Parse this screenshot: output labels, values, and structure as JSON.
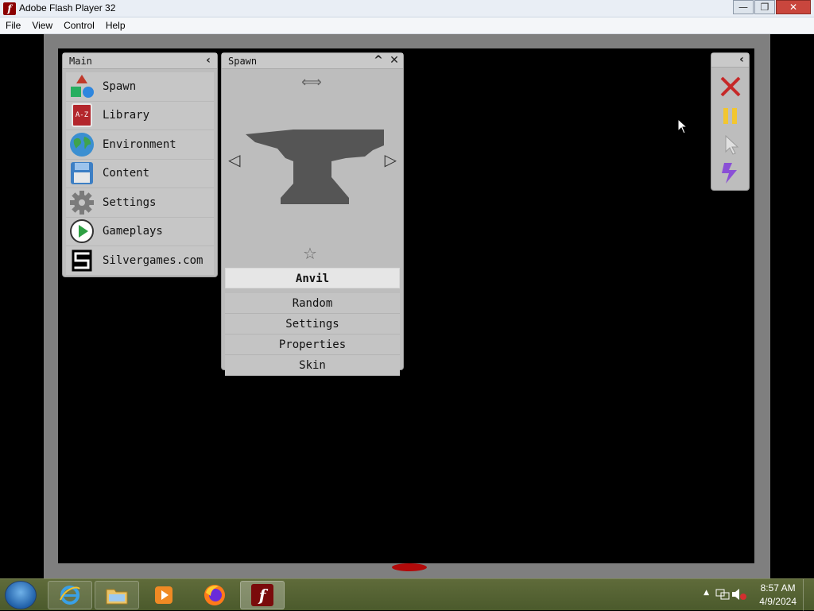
{
  "window": {
    "title": "Adobe Flash Player 32",
    "app_icon": "f",
    "buttons": {
      "minimize": "—",
      "maximize": "❐",
      "close": "✕"
    }
  },
  "menubar": {
    "items": [
      "File",
      "View",
      "Control",
      "Help"
    ]
  },
  "main_panel": {
    "title": "Main",
    "collapse_glyph": "‹",
    "items": [
      {
        "label": "Spawn",
        "icon": "shapes-icon"
      },
      {
        "label": "Library",
        "icon": "library-book-icon"
      },
      {
        "label": "Environment",
        "icon": "globe-icon"
      },
      {
        "label": "Content",
        "icon": "floppy-disk-icon"
      },
      {
        "label": "Settings",
        "icon": "gear-icon"
      },
      {
        "label": "Gameplays",
        "icon": "play-icon"
      },
      {
        "label": "Silvergames.com",
        "icon": "silvergames-logo-icon"
      }
    ],
    "library_icon_text": "A-Z"
  },
  "spawn_panel": {
    "title": "Spawn",
    "collapse_glyph": "^",
    "close_glyph": "✕",
    "move_glyph": "⟺",
    "prev_glyph": "◁",
    "next_glyph": "▷",
    "favorite_glyph": "☆",
    "selected_item": "Anvil",
    "buttons": [
      "Random",
      "Settings",
      "Properties",
      "Skin"
    ]
  },
  "tool_panel": {
    "collapse_glyph": "‹",
    "tools": [
      "delete-x-icon",
      "pause-icon",
      "pointer-icon",
      "lightning-icon"
    ]
  },
  "taskbar": {
    "apps": [
      "internet-explorer-icon",
      "file-explorer-icon",
      "media-player-icon",
      "firefox-icon",
      "flash-player-icon"
    ],
    "tray_up": "▲",
    "clock_time": "8:57 AM",
    "clock_date": "4/9/2024"
  },
  "colors": {
    "panel_bg": "#bdbdbd",
    "stage_bg": "#000000",
    "stage_border": "#7f7f7f",
    "anvil": "#555555",
    "delete_red": "#c62828",
    "pause_yellow": "#f2c62f",
    "lightning_purple": "#8a4fd6"
  }
}
